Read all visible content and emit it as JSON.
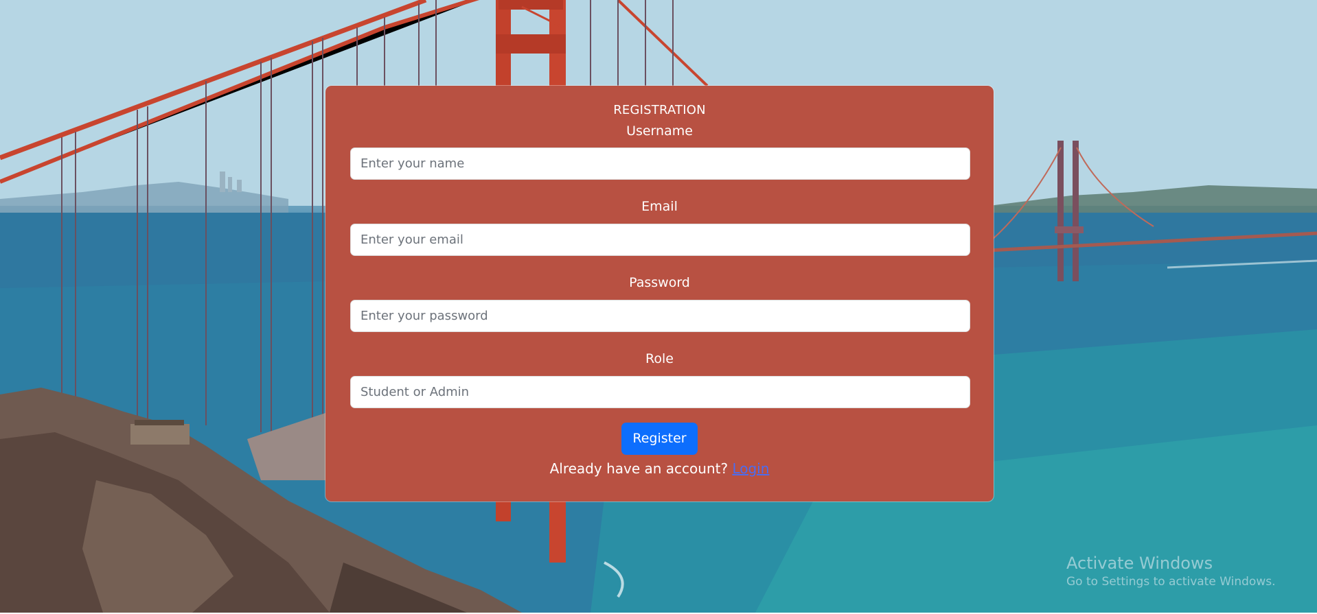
{
  "form": {
    "title": "REGISTRATION",
    "username": {
      "label": "Username",
      "placeholder": "Enter your name"
    },
    "email": {
      "label": "Email",
      "placeholder": "Enter your email"
    },
    "password": {
      "label": "Password",
      "placeholder": "Enter your password"
    },
    "role": {
      "label": "Role",
      "placeholder": "Student or Admin"
    },
    "register_label": "Register",
    "footer_text": "Already have an account?",
    "login_link": "Login"
  },
  "watermark": {
    "title": "Activate Windows",
    "subtitle": "Go to Settings to activate Windows."
  },
  "colors": {
    "card": "#b85142",
    "button": "#0d6efd",
    "link": "#4b6cf0"
  }
}
